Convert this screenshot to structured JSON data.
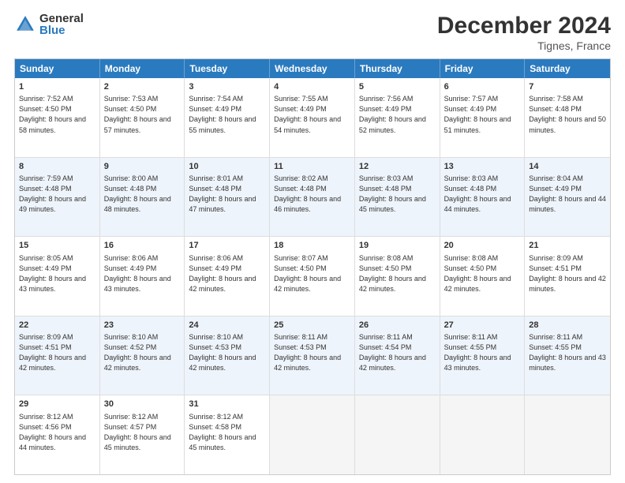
{
  "logo": {
    "general": "General",
    "blue": "Blue"
  },
  "header": {
    "month": "December 2024",
    "location": "Tignes, France"
  },
  "weekdays": [
    "Sunday",
    "Monday",
    "Tuesday",
    "Wednesday",
    "Thursday",
    "Friday",
    "Saturday"
  ],
  "rows": [
    [
      null,
      {
        "day": 2,
        "sunrise": "7:53 AM",
        "sunset": "4:50 PM",
        "daylight": "8 hours and 57 minutes."
      },
      {
        "day": 3,
        "sunrise": "7:54 AM",
        "sunset": "4:49 PM",
        "daylight": "8 hours and 55 minutes."
      },
      {
        "day": 4,
        "sunrise": "7:55 AM",
        "sunset": "4:49 PM",
        "daylight": "8 hours and 54 minutes."
      },
      {
        "day": 5,
        "sunrise": "7:56 AM",
        "sunset": "4:49 PM",
        "daylight": "8 hours and 52 minutes."
      },
      {
        "day": 6,
        "sunrise": "7:57 AM",
        "sunset": "4:49 PM",
        "daylight": "8 hours and 51 minutes."
      },
      {
        "day": 7,
        "sunrise": "7:58 AM",
        "sunset": "4:48 PM",
        "daylight": "8 hours and 50 minutes."
      }
    ],
    [
      {
        "day": 8,
        "sunrise": "7:59 AM",
        "sunset": "4:48 PM",
        "daylight": "8 hours and 49 minutes."
      },
      {
        "day": 9,
        "sunrise": "8:00 AM",
        "sunset": "4:48 PM",
        "daylight": "8 hours and 48 minutes."
      },
      {
        "day": 10,
        "sunrise": "8:01 AM",
        "sunset": "4:48 PM",
        "daylight": "8 hours and 47 minutes."
      },
      {
        "day": 11,
        "sunrise": "8:02 AM",
        "sunset": "4:48 PM",
        "daylight": "8 hours and 46 minutes."
      },
      {
        "day": 12,
        "sunrise": "8:03 AM",
        "sunset": "4:48 PM",
        "daylight": "8 hours and 45 minutes."
      },
      {
        "day": 13,
        "sunrise": "8:03 AM",
        "sunset": "4:48 PM",
        "daylight": "8 hours and 44 minutes."
      },
      {
        "day": 14,
        "sunrise": "8:04 AM",
        "sunset": "4:49 PM",
        "daylight": "8 hours and 44 minutes."
      }
    ],
    [
      {
        "day": 15,
        "sunrise": "8:05 AM",
        "sunset": "4:49 PM",
        "daylight": "8 hours and 43 minutes."
      },
      {
        "day": 16,
        "sunrise": "8:06 AM",
        "sunset": "4:49 PM",
        "daylight": "8 hours and 43 minutes."
      },
      {
        "day": 17,
        "sunrise": "8:06 AM",
        "sunset": "4:49 PM",
        "daylight": "8 hours and 42 minutes."
      },
      {
        "day": 18,
        "sunrise": "8:07 AM",
        "sunset": "4:50 PM",
        "daylight": "8 hours and 42 minutes."
      },
      {
        "day": 19,
        "sunrise": "8:08 AM",
        "sunset": "4:50 PM",
        "daylight": "8 hours and 42 minutes."
      },
      {
        "day": 20,
        "sunrise": "8:08 AM",
        "sunset": "4:50 PM",
        "daylight": "8 hours and 42 minutes."
      },
      {
        "day": 21,
        "sunrise": "8:09 AM",
        "sunset": "4:51 PM",
        "daylight": "8 hours and 42 minutes."
      }
    ],
    [
      {
        "day": 22,
        "sunrise": "8:09 AM",
        "sunset": "4:51 PM",
        "daylight": "8 hours and 42 minutes."
      },
      {
        "day": 23,
        "sunrise": "8:10 AM",
        "sunset": "4:52 PM",
        "daylight": "8 hours and 42 minutes."
      },
      {
        "day": 24,
        "sunrise": "8:10 AM",
        "sunset": "4:53 PM",
        "daylight": "8 hours and 42 minutes."
      },
      {
        "day": 25,
        "sunrise": "8:11 AM",
        "sunset": "4:53 PM",
        "daylight": "8 hours and 42 minutes."
      },
      {
        "day": 26,
        "sunrise": "8:11 AM",
        "sunset": "4:54 PM",
        "daylight": "8 hours and 42 minutes."
      },
      {
        "day": 27,
        "sunrise": "8:11 AM",
        "sunset": "4:55 PM",
        "daylight": "8 hours and 43 minutes."
      },
      {
        "day": 28,
        "sunrise": "8:11 AM",
        "sunset": "4:55 PM",
        "daylight": "8 hours and 43 minutes."
      }
    ],
    [
      {
        "day": 29,
        "sunrise": "8:12 AM",
        "sunset": "4:56 PM",
        "daylight": "8 hours and 44 minutes."
      },
      {
        "day": 30,
        "sunrise": "8:12 AM",
        "sunset": "4:57 PM",
        "daylight": "8 hours and 45 minutes."
      },
      {
        "day": 31,
        "sunrise": "8:12 AM",
        "sunset": "4:58 PM",
        "daylight": "8 hours and 45 minutes."
      },
      null,
      null,
      null,
      null
    ]
  ],
  "first_row": [
    {
      "day": 1,
      "sunrise": "7:52 AM",
      "sunset": "4:50 PM",
      "daylight": "8 hours and 58 minutes."
    },
    null,
    null,
    null,
    null,
    null,
    null
  ]
}
